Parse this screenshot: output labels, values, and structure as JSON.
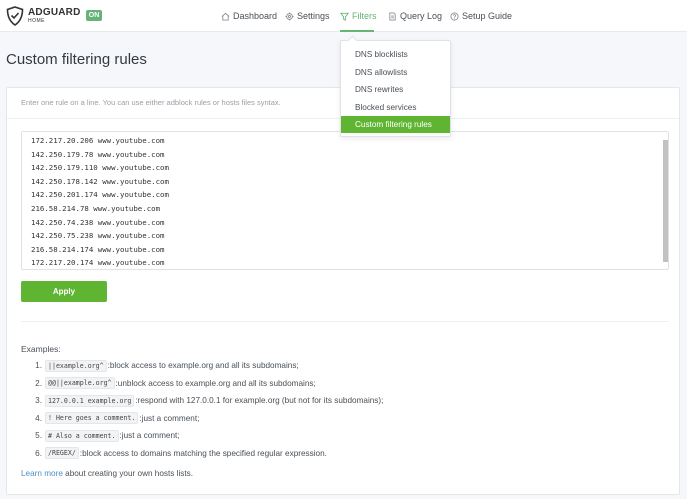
{
  "brand": {
    "name": "ADGUARD",
    "sub": "HOME",
    "status_badge": "ON"
  },
  "nav": [
    {
      "label": "Dashboard",
      "icon": "home-icon"
    },
    {
      "label": "Settings",
      "icon": "gear-icon"
    },
    {
      "label": "Filters",
      "icon": "filter-icon",
      "active": true
    },
    {
      "label": "Query Log",
      "icon": "document-icon"
    },
    {
      "label": "Setup Guide",
      "icon": "help-circle-icon"
    }
  ],
  "page_title": "Custom filtering rules",
  "description": "Enter one rule on a line. You can use either adblock rules or hosts files syntax.",
  "rules": [
    "172.217.20.206 www.youtube.com",
    "142.250.179.78 www.youtube.com",
    "142.250.179.110 www.youtube.com",
    "142.250.178.142 www.youtube.com",
    "142.250.201.174 www.youtube.com",
    "216.58.214.78 www.youtube.com",
    "142.250.74.238 www.youtube.com",
    "142.250.75.238 www.youtube.com",
    "216.58.214.174 www.youtube.com",
    "172.217.20.174 www.youtube.com"
  ],
  "apply_label": "Apply",
  "examples_title": "Examples:",
  "examples": [
    {
      "num": "1.",
      "code": "||example.org^",
      "text": ":block access to example.org and all its subdomains;"
    },
    {
      "num": "2.",
      "code": "@@||example.org^",
      "text": ":unblock access to example.org and all its subdomains;"
    },
    {
      "num": "3.",
      "code": "127.0.0.1 example.org",
      "text": ":respond with 127.0.0.1 for example.org (but not for its subdomains);"
    },
    {
      "num": "4.",
      "code": "! Here goes a comment.",
      "text": ":just a comment;"
    },
    {
      "num": "5.",
      "code": "# Also a comment.",
      "text": ":just a comment;"
    },
    {
      "num": "6.",
      "code": "/REGEX/",
      "text": ":block access to domains matching the specified regular expression."
    }
  ],
  "learn_more": {
    "link": "Learn more",
    "text": " about creating your own hosts lists."
  },
  "dropdown": [
    {
      "label": "DNS blocklists"
    },
    {
      "label": "DNS allowlists"
    },
    {
      "label": "DNS rewrites"
    },
    {
      "label": "Blocked services"
    },
    {
      "label": "Custom filtering rules",
      "active": true
    }
  ],
  "colors": {
    "accent": "#5fb532",
    "nav_active": "#66b574",
    "link": "#4a90c8"
  }
}
